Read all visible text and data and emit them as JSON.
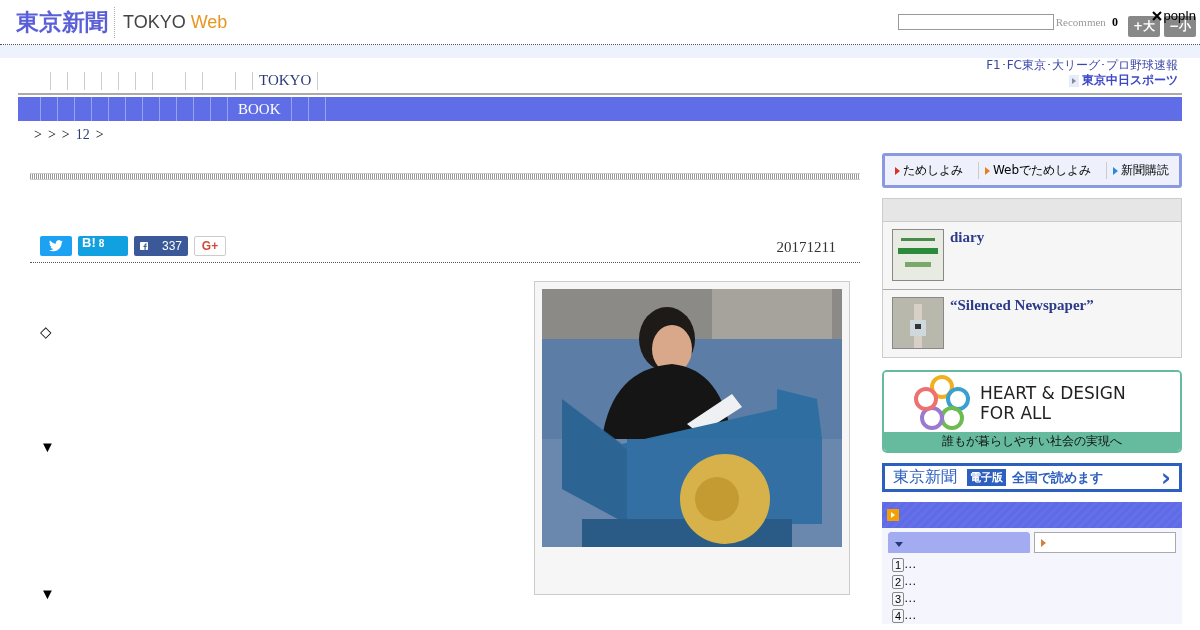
{
  "header": {
    "logo": "東京新聞",
    "brand": "TOKYO",
    "brand_accent": "Web",
    "recommend": "Recommen",
    "count": "0",
    "font_buttons": [
      "+大",
      "−小"
    ],
    "popin": "popIn"
  },
  "nav": {
    "link": "TOKYO",
    "promo_line": "F1･FC東京･大リーグ･プロ野球速報",
    "promo_title": "東京中日スポーツ"
  },
  "category_bar": {
    "tab": "BOOK"
  },
  "breadcrumb": [
    ">",
    ">",
    ">",
    "12",
    ">"
  ],
  "share": [
    {
      "kind": "twitter"
    },
    {
      "kind": "hatena",
      "label": "B!",
      "count": "8"
    },
    {
      "kind": "facebook",
      "count": "337"
    },
    {
      "kind": "gplus",
      "label": "G+"
    }
  ],
  "date": "20171211",
  "body": [
    "◇",
    "▼",
    "▼"
  ],
  "photo": {
    "kind": "picture"
  },
  "sidebar": {
    "trial_links": [
      {
        "label": "ためしよみ",
        "color": "#e03020"
      },
      {
        "label": "Webでためしよみ",
        "color": "#f07a20"
      },
      {
        "label": "新聞購読",
        "color": "#2a8ae0"
      }
    ],
    "features": [
      {
        "title": "diary"
      },
      {
        "title": "“Silenced Newspaper”"
      }
    ],
    "banner": {
      "title_line1": "HEART & DESIGN",
      "title_line2": "FOR ALL",
      "caption": "誰もが暮らしやすい社会の実現へ"
    },
    "epaper": {
      "logo": "東京新聞",
      "badge": "電子版",
      "text": "全国で読めます",
      "arrow": "›"
    },
    "ranking": {
      "tabs": [
        {
          "selected": true
        },
        {
          "selected": false
        }
      ],
      "items": [
        "1",
        "2",
        "3",
        "4"
      ],
      "ellipsis": "…"
    }
  }
}
